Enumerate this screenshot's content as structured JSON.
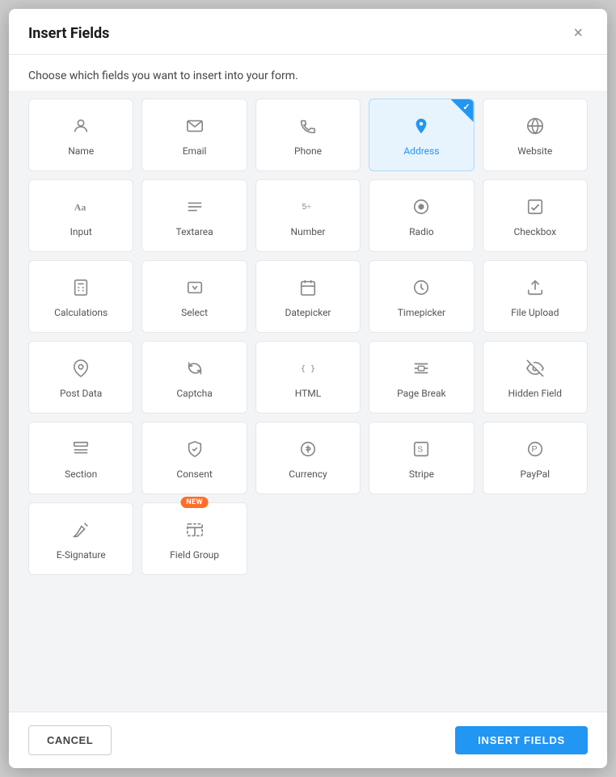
{
  "modal": {
    "title": "Insert Fields",
    "subtitle": "Choose which fields you want to insert into your form.",
    "close_label": "×"
  },
  "footer": {
    "cancel_label": "CANCEL",
    "insert_label": "INSERT FIELDS"
  },
  "fields": [
    {
      "id": "name",
      "label": "Name",
      "icon": "person",
      "selected": false
    },
    {
      "id": "email",
      "label": "Email",
      "icon": "email",
      "selected": false
    },
    {
      "id": "phone",
      "label": "Phone",
      "icon": "phone",
      "selected": false
    },
    {
      "id": "address",
      "label": "Address",
      "icon": "location",
      "selected": true
    },
    {
      "id": "website",
      "label": "Website",
      "icon": "globe",
      "selected": false
    },
    {
      "id": "input",
      "label": "Input",
      "icon": "input",
      "selected": false
    },
    {
      "id": "textarea",
      "label": "Textarea",
      "icon": "textarea",
      "selected": false
    },
    {
      "id": "number",
      "label": "Number",
      "icon": "number",
      "selected": false
    },
    {
      "id": "radio",
      "label": "Radio",
      "icon": "radio",
      "selected": false
    },
    {
      "id": "checkbox",
      "label": "Checkbox",
      "icon": "checkbox",
      "selected": false
    },
    {
      "id": "calculations",
      "label": "Calculations",
      "icon": "calc",
      "selected": false
    },
    {
      "id": "select",
      "label": "Select",
      "icon": "select",
      "selected": false
    },
    {
      "id": "datepicker",
      "label": "Datepicker",
      "icon": "date",
      "selected": false
    },
    {
      "id": "timepicker",
      "label": "Timepicker",
      "icon": "time",
      "selected": false
    },
    {
      "id": "file-upload",
      "label": "File Upload",
      "icon": "upload",
      "selected": false
    },
    {
      "id": "post-data",
      "label": "Post Data",
      "icon": "pin",
      "selected": false
    },
    {
      "id": "captcha",
      "label": "Captcha",
      "icon": "captcha",
      "selected": false
    },
    {
      "id": "html",
      "label": "HTML",
      "icon": "html",
      "selected": false
    },
    {
      "id": "page-break",
      "label": "Page Break",
      "icon": "pagebreak",
      "selected": false
    },
    {
      "id": "hidden-field",
      "label": "Hidden Field",
      "icon": "hidden",
      "selected": false
    },
    {
      "id": "section",
      "label": "Section",
      "icon": "section",
      "selected": false
    },
    {
      "id": "consent",
      "label": "Consent",
      "icon": "consent",
      "selected": false
    },
    {
      "id": "currency",
      "label": "Currency",
      "icon": "currency",
      "selected": false
    },
    {
      "id": "stripe",
      "label": "Stripe",
      "icon": "stripe",
      "selected": false
    },
    {
      "id": "paypal",
      "label": "PayPal",
      "icon": "paypal",
      "selected": false
    },
    {
      "id": "e-signature",
      "label": "E-Signature",
      "icon": "signature",
      "selected": false
    },
    {
      "id": "field-group",
      "label": "Field Group",
      "icon": "fieldgroup",
      "selected": false,
      "new": true
    }
  ]
}
